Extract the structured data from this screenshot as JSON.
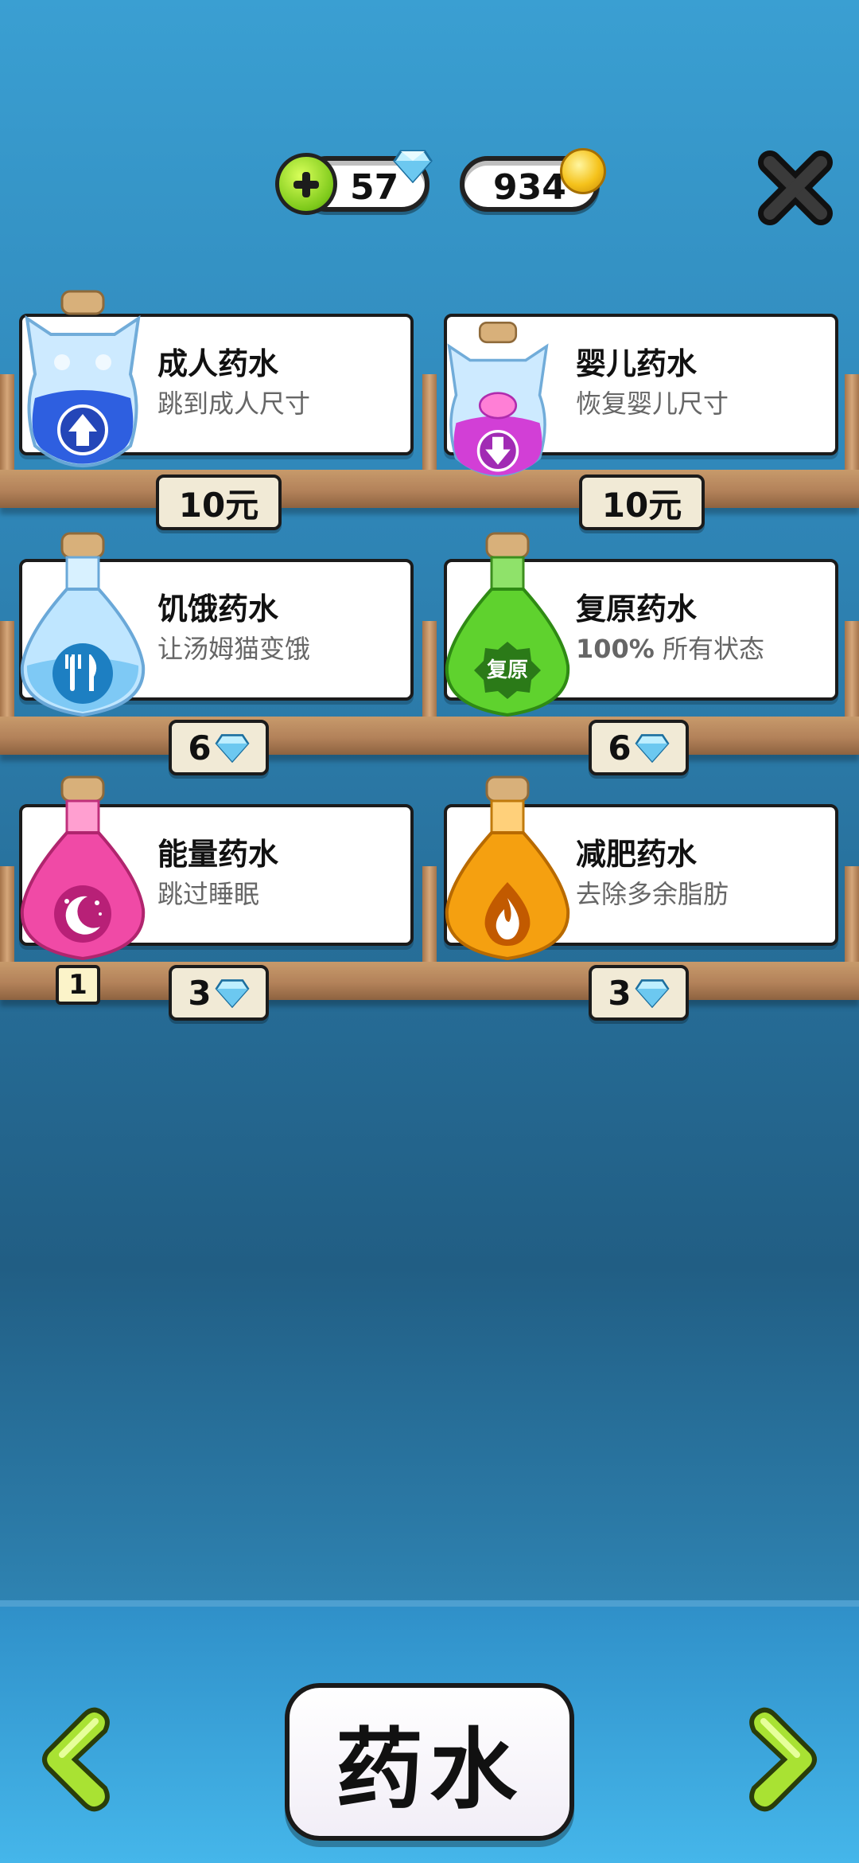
{
  "header": {
    "gems": "57",
    "coins": "934"
  },
  "potions": [
    {
      "title": "成人药水",
      "subtitle": "跳到成人尺寸",
      "price": "10元",
      "currency": "cash",
      "icon": "arrow-up-icon",
      "color": "#2e5fe0"
    },
    {
      "title": "婴儿药水",
      "subtitle": "恢复婴儿尺寸",
      "price": "10元",
      "currency": "cash",
      "icon": "arrow-down-icon",
      "color": "#d23fd6"
    },
    {
      "title": "饥饿药水",
      "subtitle": "让汤姆猫变饿",
      "price": "6",
      "currency": "gem",
      "icon": "fork-knife-icon",
      "color": "#8fd3ff"
    },
    {
      "title": "复原药水",
      "subtitle_bold": "100%",
      "subtitle": " 所有状态",
      "price": "6",
      "currency": "gem",
      "icon": "restore-badge-icon",
      "icon_label": "复原",
      "color": "#4fc428"
    },
    {
      "title": "能量药水",
      "subtitle": "跳过睡眠",
      "price": "3",
      "currency": "gem",
      "icon": "moon-stars-icon",
      "color": "#f04aa6",
      "owned_count": "1"
    },
    {
      "title": "减肥药水",
      "subtitle": "去除多余脂肪",
      "price": "3",
      "currency": "gem",
      "icon": "flame-icon",
      "color": "#f5a010"
    }
  ],
  "footer": {
    "category_title": "药水"
  },
  "colors": {
    "accent_green": "#8fd42a",
    "shelf_wood": "#b98a60",
    "gem_blue": "#7fd3ff"
  }
}
